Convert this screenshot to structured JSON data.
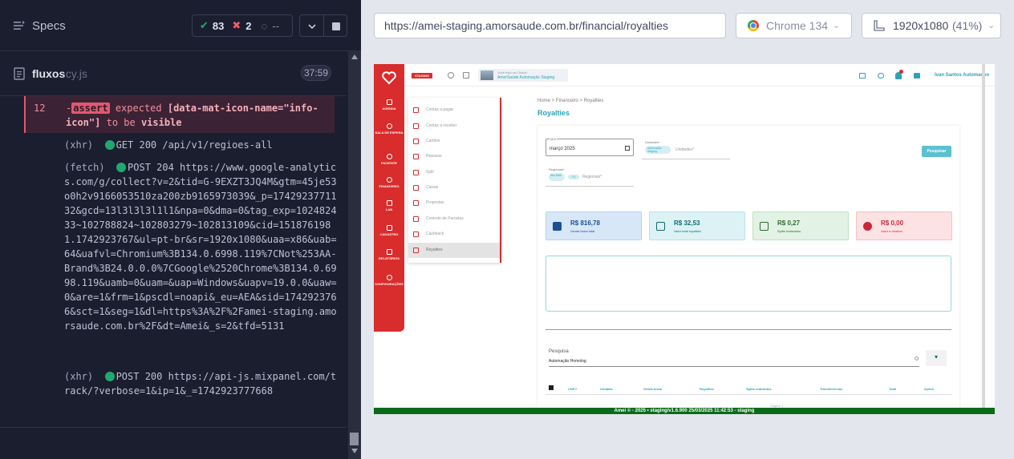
{
  "runner": {
    "specs_label": "Specs",
    "stats": {
      "passed": "83",
      "failed": "2",
      "pending": "--"
    },
    "file": {
      "name": "fluxos",
      "ext": ".cy.js",
      "duration": "37:59"
    },
    "error": {
      "line": "12",
      "prefix": "-",
      "keyword": "assert",
      "text1": "expected",
      "selector": "[data-mat-icon-name=\"info-icon\"]",
      "to_be": "to be",
      "state": "visible"
    },
    "commands": [
      {
        "type": "(xhr)",
        "text": "GET 200 /api/v1/regioes-all"
      },
      {
        "type": "(fetch)",
        "text": "POST 204 https://www.google-analytics.com/g/collect?v=2&tid=G-9EXZT3JQ4M&gtm=45je53o0h2v9166053510za200zb9165973039&_p=1742923771132&gcd=13l3l3l3l1l1&npa=0&dma=0&tag_exp=102482433~102788824~102803279~102813109&cid=1518761981.1742923767&ul=pt-br&sr=1920x1080&uaa=x86&uab=64&uafvl=Chromium%3B134.0.6998.119%7CNot%253AA-Brand%3B24.0.0.0%7CGoogle%2520Chrome%3B134.0.6998.119&uamb=0&uam=&uap=Windows&uapv=19.0.0&uaw=0&are=1&frm=1&pscdl=noapi&_eu=AEA&sid=1742923766&sct=1&seg=1&dl=https%3A%2F%2Famei-staging.amorsaude.com.br%2F&dt=Amei&_s=2&tfd=5131"
      },
      {
        "type": "(xhr)",
        "text": "POST 200 https://api-js.mixpanel.com/track/?verbose=1&ip=1&_=1742923777668"
      }
    ]
  },
  "browser": {
    "url": "https://amei-staging.amorsaude.com.br/financial/royalties",
    "name": "Chrome 134",
    "viewport": "1920x1080",
    "zoom": "(41%)"
  },
  "app": {
    "env_badge": "STAGING",
    "unit_chip": {
      "line1": "Você está na Clínica:",
      "line2": "AmorSaúde Automação Staging"
    },
    "user_name": "Ivan Santos Automaçoo",
    "nav": [
      "AGENDA",
      "SALA DE ESPERA",
      "PACIENTE",
      "FINANCEIRO",
      "LAB",
      "CADASTRO",
      "RELATÓRIOS",
      "CONFIGURAÇÕES"
    ],
    "submenu": [
      "Contas a pagar",
      "Contas a receber",
      "Cartões",
      "Repasse",
      "Split",
      "Caixas",
      "Propostas",
      "Controle de Parcelas",
      "Cashback",
      "Royalties"
    ],
    "breadcrumb": "Home > Financeiro > Royalties",
    "title": "Royalties",
    "filters": {
      "mes_label": "M/A",
      "mes_value": "março 2025",
      "unidades_label": "Unidades*",
      "unidades_chip": "Automação Staging",
      "unidades_placeholder": "Unidades*",
      "regionais_label": "Regionais*",
      "regionais_chip1": "Alto Belé",
      "regionais_chip2": "+11",
      "regionais_placeholder": "Regionais*",
      "button": "Pesquisar"
    },
    "kpis": [
      {
        "value": "R$ 816,78",
        "label": "Venda bruta total"
      },
      {
        "value": "R$ 32,53",
        "label": "Valor total royalties"
      },
      {
        "value": "R$ 0,27",
        "label": "Splits realizados"
      },
      {
        "value": "R$ 0,00",
        "label": "Valor a receber"
      }
    ],
    "search": {
      "label": "Pesquisa",
      "value": "Automação Homolog"
    },
    "table_headers": [
      "CNPJ",
      "Unidade",
      "Venda bruta",
      "Royalties",
      "Splits realizados",
      "Transferências",
      "Total",
      "Ações"
    ],
    "pager": "Página: 1",
    "footer": "Amei © - 2025 • staging/v1.6.900 25/03/2025 11:42:53 - staging"
  },
  "colors": {
    "accent_red": "#d92c2c",
    "teal": "#2aa3b8",
    "footer_green": "#0b6b1a"
  }
}
